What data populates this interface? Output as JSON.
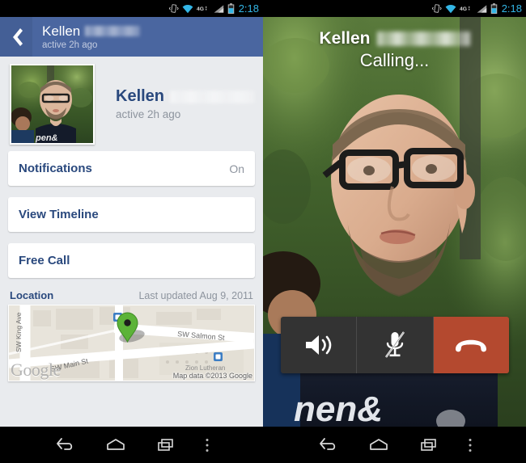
{
  "status_bar": {
    "time": "2:18",
    "icons": [
      "vibrate-icon",
      "wifi-icon",
      "4g-lte-icon",
      "signal-bars-icon",
      "battery-icon"
    ],
    "network_label": "4G",
    "accent_color": "#33b5e5"
  },
  "left_screen": {
    "header": {
      "back_icon": "back-chevron-icon",
      "name": "Kellen",
      "name_redacted": true,
      "subtitle": "active 2h ago",
      "bg_color": "#4a66a0"
    },
    "profile": {
      "name": "Kellen",
      "name_redacted": true,
      "subtitle": "active 2h ago",
      "photo_alt": "profile-photo"
    },
    "cards": [
      {
        "label": "Notifications",
        "value": "On"
      },
      {
        "label": "View Timeline",
        "value": ""
      },
      {
        "label": "Free Call",
        "value": ""
      }
    ],
    "location": {
      "title": "Location",
      "last_updated": "Last updated Aug 9, 2011",
      "map": {
        "streets": [
          "SW King Ave",
          "SW Main St",
          "SW Salmon St"
        ],
        "place_label": "Zion Lutheran",
        "attribution": "Map data ©2013 Google",
        "watermark": "Google",
        "pin_color": "#5cb338"
      }
    }
  },
  "right_screen": {
    "call": {
      "name": "Kellen",
      "name_redacted": true,
      "status": "Calling...",
      "controls": [
        {
          "name": "speaker-button",
          "icon": "speaker-icon",
          "label": "Speaker",
          "color": "#333333"
        },
        {
          "name": "mute-button",
          "icon": "microphone-muted-icon",
          "label": "Mute",
          "color": "#333333"
        },
        {
          "name": "end-call-button",
          "icon": "phone-hangup-icon",
          "label": "End call",
          "color": "#b4492f"
        }
      ]
    }
  },
  "nav_bar": {
    "buttons": [
      {
        "name": "back-button",
        "icon": "back-arrow-icon"
      },
      {
        "name": "home-button",
        "icon": "home-icon"
      },
      {
        "name": "recents-button",
        "icon": "recent-apps-icon"
      },
      {
        "name": "overflow-menu-button",
        "icon": "overflow-menu-icon"
      }
    ]
  }
}
